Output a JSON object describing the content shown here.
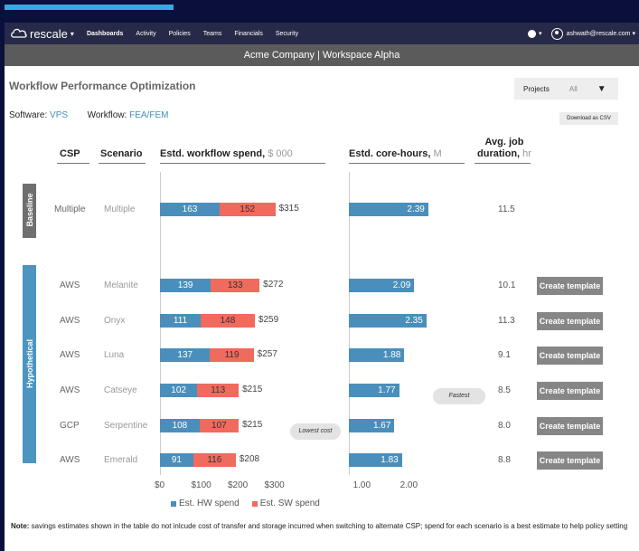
{
  "nav": {
    "brand": "rescale",
    "items": [
      {
        "label": "Dashboards",
        "active": true
      },
      {
        "label": "Activity",
        "active": false
      },
      {
        "label": "Policies",
        "active": false
      },
      {
        "label": "Teams",
        "active": false
      },
      {
        "label": "Financials",
        "active": false
      },
      {
        "label": "Security",
        "active": false
      }
    ],
    "user_email": "ashwath@rescale.com",
    "icons": [
      "rescale-logo-icon",
      "globe-icon",
      "user-avatar-icon",
      "chevron-down-icon"
    ]
  },
  "workspace_title": "Acme Company | Workspace Alpha",
  "page_title": "Workflow Performance Optimization",
  "projects_filter": {
    "label": "Projects",
    "value": "All"
  },
  "software": {
    "label": "Software:",
    "value": "VPS"
  },
  "workflow": {
    "label": "Workflow:",
    "value": "FEA/FEM"
  },
  "download_label": "Download as CSV",
  "columns": {
    "csp": "CSP",
    "scenario": "Scenario",
    "spend": "Estd. workflow spend,",
    "spend_unit": "$ 000",
    "core": "Estd. core-hours,",
    "core_unit": "M",
    "duration": "Avg. job",
    "duration2": "duration,",
    "duration_unit": "hr"
  },
  "groups": {
    "baseline": "Baseline",
    "hypothetical": "Hypothetical"
  },
  "rows": [
    {
      "csp": "Multiple",
      "scenario": "Multiple",
      "hw": 163,
      "sw": 152,
      "total": "$315",
      "core": 2.39,
      "core_label": "2.39",
      "duration": "11.5",
      "button": ""
    },
    {
      "csp": "AWS",
      "scenario": "Melanite",
      "hw": 139,
      "sw": 133,
      "total": "$272",
      "core": 2.09,
      "core_label": "2.09",
      "duration": "10.1",
      "button": "Create template"
    },
    {
      "csp": "AWS",
      "scenario": "Onyx",
      "hw": 111,
      "sw": 148,
      "total": "$259",
      "core": 2.35,
      "core_label": "2.35",
      "duration": "11.3",
      "button": "Create template"
    },
    {
      "csp": "AWS",
      "scenario": "Luna",
      "hw": 137,
      "sw": 119,
      "total": "$257",
      "core": 1.88,
      "core_label": "1.88",
      "duration": "9.1",
      "button": "Create template"
    },
    {
      "csp": "AWS",
      "scenario": "Catseye",
      "hw": 102,
      "sw": 113,
      "total": "$215",
      "core": 1.77,
      "core_label": "1.77",
      "duration": "8.5",
      "button": "Create template"
    },
    {
      "csp": "GCP",
      "scenario": "Serpentine",
      "hw": 108,
      "sw": 107,
      "total": "$215",
      "core": 1.67,
      "core_label": "1.67",
      "duration": "8.0",
      "button": "Create template"
    },
    {
      "csp": "AWS",
      "scenario": "Emerald",
      "hw": 91,
      "sw": 116,
      "total": "$208",
      "core": 1.83,
      "core_label": "1.83",
      "duration": "8.8",
      "button": "Create template"
    }
  ],
  "badges": {
    "fastest": "Fastest",
    "lowest_cost": "Lowest cost"
  },
  "spend_axis": {
    "ticks": [
      "$0",
      "$100",
      "$200",
      "$300"
    ],
    "tick_values": [
      0,
      100,
      200,
      300
    ],
    "max": 330
  },
  "core_axis": {
    "ticks": [
      "1.00",
      "2.00"
    ],
    "tick_values": [
      1.0,
      2.0
    ],
    "min": 0.7,
    "max": 2.7
  },
  "legend": {
    "hw": "Est. HW spend",
    "sw": "Est. SW spend"
  },
  "colors": {
    "hw": "#4a8fbb",
    "sw": "#f06a5d",
    "accent": "#3f8fbf"
  },
  "note_bold": "Note:",
  "note_text": " savings estimates shown in the table do not inlcude cost of transfer and storage incurred when switching to alternate CSP;  spend for each scenario is a best estimate to help policy setting"
}
